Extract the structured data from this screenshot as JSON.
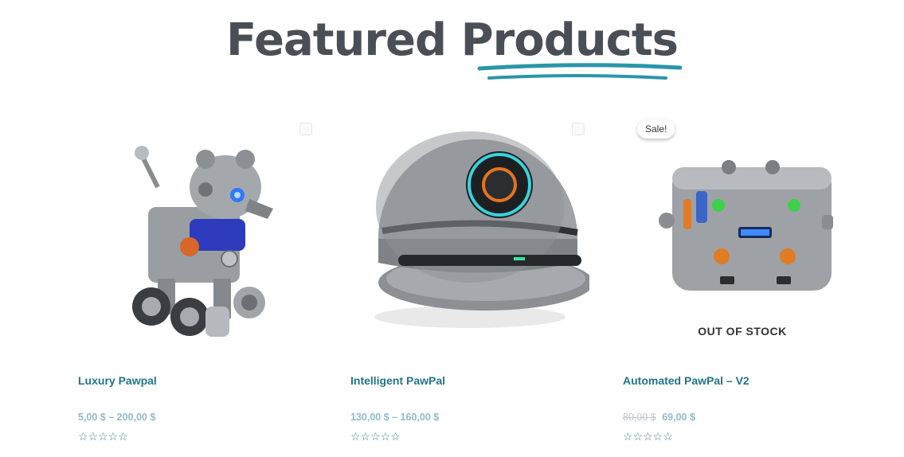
{
  "heading": {
    "word1": "Featured",
    "word2": "Products"
  },
  "products": [
    {
      "title": "Luxury Pawpal",
      "price": "5,00 $ – 200,00 $",
      "rating_stars": "☆☆☆☆☆",
      "rating": 0
    },
    {
      "title": "Intelligent PawPal",
      "price": "130,00 $ – 160,00 $",
      "rating_stars": "☆☆☆☆☆",
      "rating": 0
    },
    {
      "title": "Automated PawPal – V2",
      "old_price": "80,00 $",
      "price": "69,00 $",
      "rating_stars": "☆☆☆☆☆",
      "rating": 0,
      "badge": "Sale!",
      "stock_status": "OUT OF STOCK"
    }
  ],
  "colors": {
    "heading": "#4a4f57",
    "accent": "#2a96a8",
    "link": "#23748a",
    "price": "#8fbacb"
  },
  "icons": {
    "wishlist": "wishlist-icon",
    "star": "star-icon"
  }
}
